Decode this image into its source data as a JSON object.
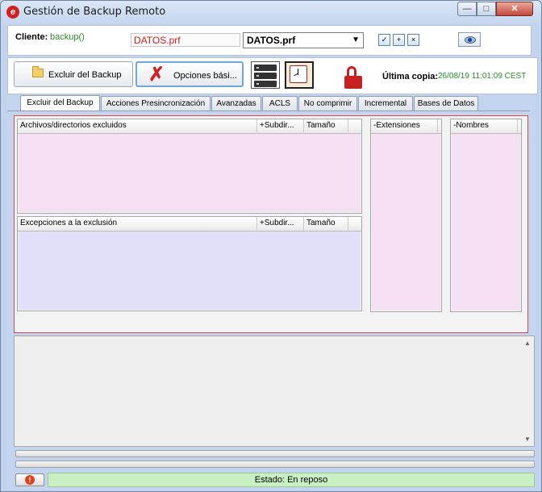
{
  "window": {
    "title": "Gestión de Backup Remoto",
    "min_glyph": "—",
    "max_glyph": "□",
    "close_glyph": "✕"
  },
  "client": {
    "label": "Cliente:",
    "value": "backup()",
    "profile_field": "DATOS.prf",
    "profile_selected": "DATOS.prf"
  },
  "toolbar": {
    "exclude_button": "Excluir del Backup",
    "options_button": "Opciones bási...",
    "last_copy_label": "Última copia:",
    "last_copy_value": "26/08/19 11:01:09 CEST"
  },
  "tabs": [
    "Excluir del Backup",
    "Acciones Presincronización",
    "Avanzadas",
    "ACLS",
    "No comprimir",
    "Incremental",
    "Bases de Datos"
  ],
  "excluded": {
    "col_path": "Archivos/directorios excluidos",
    "col_subdirs": "+Subdir...",
    "col_size": "Tamaño"
  },
  "exceptions": {
    "col_path": "Excepciones a la exclusión",
    "col_subdirs": "+Subdir...",
    "col_size": "Tamaño"
  },
  "extensions": {
    "header": "-Extensiones"
  },
  "names": {
    "header": "-Nombres"
  },
  "status": {
    "text": "Estado: En reposo"
  },
  "colors": {
    "pink_panel": "#f6e1f4",
    "lavender_panel": "#e0e0f9",
    "status_bg": "#c9f0c3",
    "accent_red": "#d42020",
    "value_green": "#2a8a2a"
  }
}
